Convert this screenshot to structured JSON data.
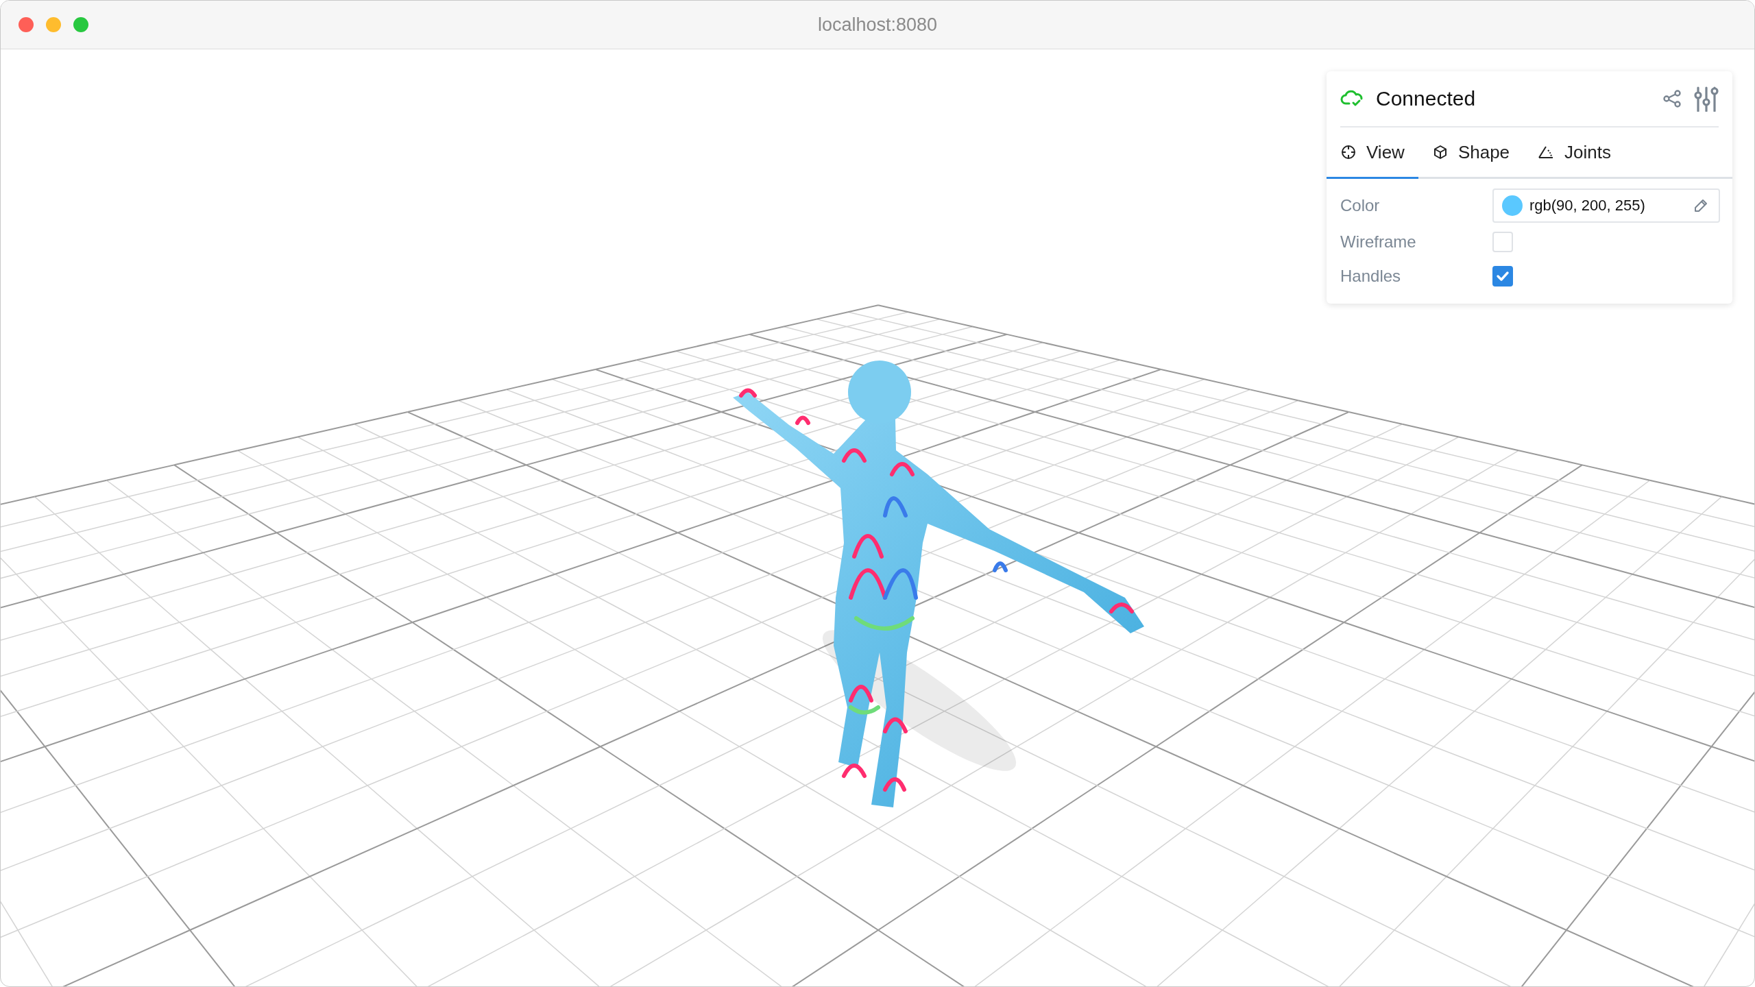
{
  "window": {
    "title": "localhost:8080"
  },
  "panel": {
    "status": "Connected",
    "tabs": [
      {
        "label": "View",
        "selected": true
      },
      {
        "label": "Shape",
        "selected": false
      },
      {
        "label": "Joints",
        "selected": false
      }
    ],
    "settings": [
      {
        "kind": "color",
        "label": "Color",
        "value": "rgb(90, 200, 255)",
        "color": "#5ac8ff"
      },
      {
        "kind": "checkbox",
        "label": "Wireframe",
        "checked": false
      },
      {
        "kind": "checkbox",
        "label": "Handles",
        "checked": true
      }
    ]
  }
}
